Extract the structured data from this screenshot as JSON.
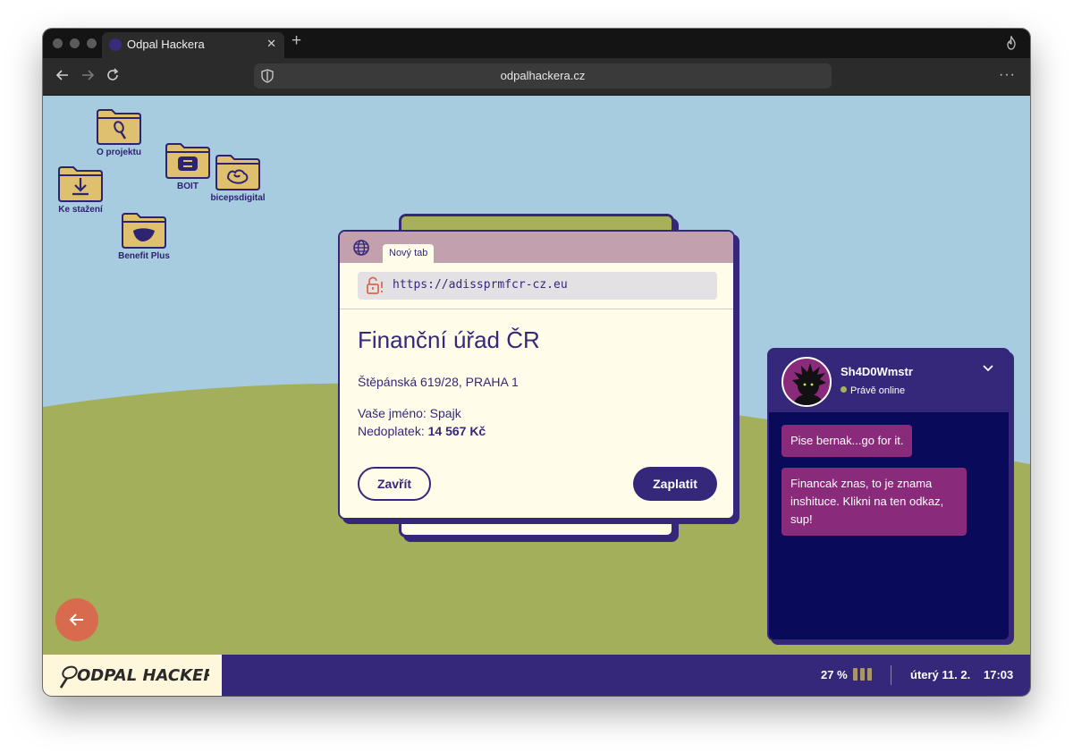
{
  "browser": {
    "tab_title": "Odpal Hackera",
    "url": "odpalhackera.cz"
  },
  "desktop": {
    "icons": [
      {
        "label": "O projektu",
        "icon": "racket-icon"
      },
      {
        "label": "BOIT",
        "icon": "boit-logo-icon"
      },
      {
        "label": "bicepsdigital",
        "icon": "biceps-icon"
      },
      {
        "label": "Ke stažení",
        "icon": "download-icon"
      },
      {
        "label": "Benefit Plus",
        "icon": "benefit-plus-icon"
      }
    ]
  },
  "popup": {
    "tab_label": "Nový tab",
    "url": "https://adissprmfcr-cz.eu",
    "title": "Finanční úřad ČR",
    "address": "Štěpánská 619/28, PRAHA 1",
    "name_line": "Vaše jméno: Spajk",
    "debt_label": "Nedoplatek:",
    "debt_value": "14 567 Kč",
    "close_label": "Zavřít",
    "pay_label": "Zaplatit"
  },
  "chat": {
    "username": "Sh4D0Wmstr",
    "status": "Právě online",
    "messages": [
      "Pise bernak...go for it.",
      "Financak znas, to je znama inshituce. Klikni na ten odkaz, sup!"
    ]
  },
  "taskbar": {
    "logo_text": "ODPAL HACKERA",
    "battery": "27 %",
    "date": "úterý 11. 2.",
    "time": "17:03"
  },
  "colors": {
    "sky": "#a7cce0",
    "grass": "#a3af5a",
    "primary": "#35287a",
    "chat_bg": "#0a0a5a",
    "message_bg": "#8a2a7a",
    "folder": "#dfc06e",
    "fab": "#d86a4e"
  }
}
